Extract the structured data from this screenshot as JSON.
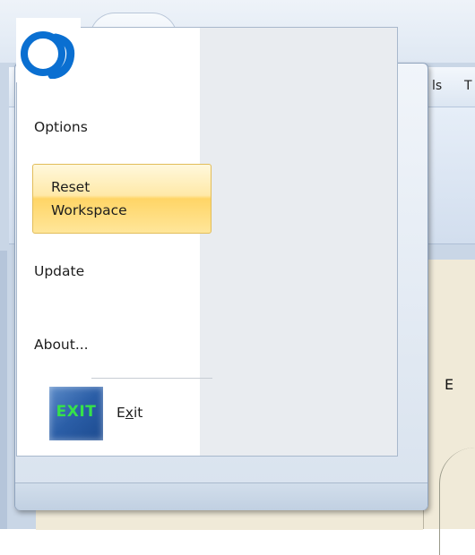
{
  "window": {
    "menu_bar": {
      "partial_items": [
        "ls",
        "T"
      ]
    },
    "content": {
      "partial_text": "E"
    }
  },
  "app_button": {
    "icon": "app-logo-icon",
    "accent": "#0066cc"
  },
  "app_menu": {
    "items": [
      {
        "label": "Options"
      },
      {
        "label_line1": "Reset",
        "label_line2": "Workspace",
        "highlighted": true
      },
      {
        "label": "Update"
      },
      {
        "label": "About..."
      }
    ],
    "exit": {
      "icon_text": "EXIT",
      "label_before": "E",
      "label_mnemonic": "x",
      "label_after": "it"
    }
  },
  "colors": {
    "highlight": "#ffd566",
    "exit_icon_text": "#36e24a",
    "exit_icon_bg": "#2b5ea7"
  }
}
